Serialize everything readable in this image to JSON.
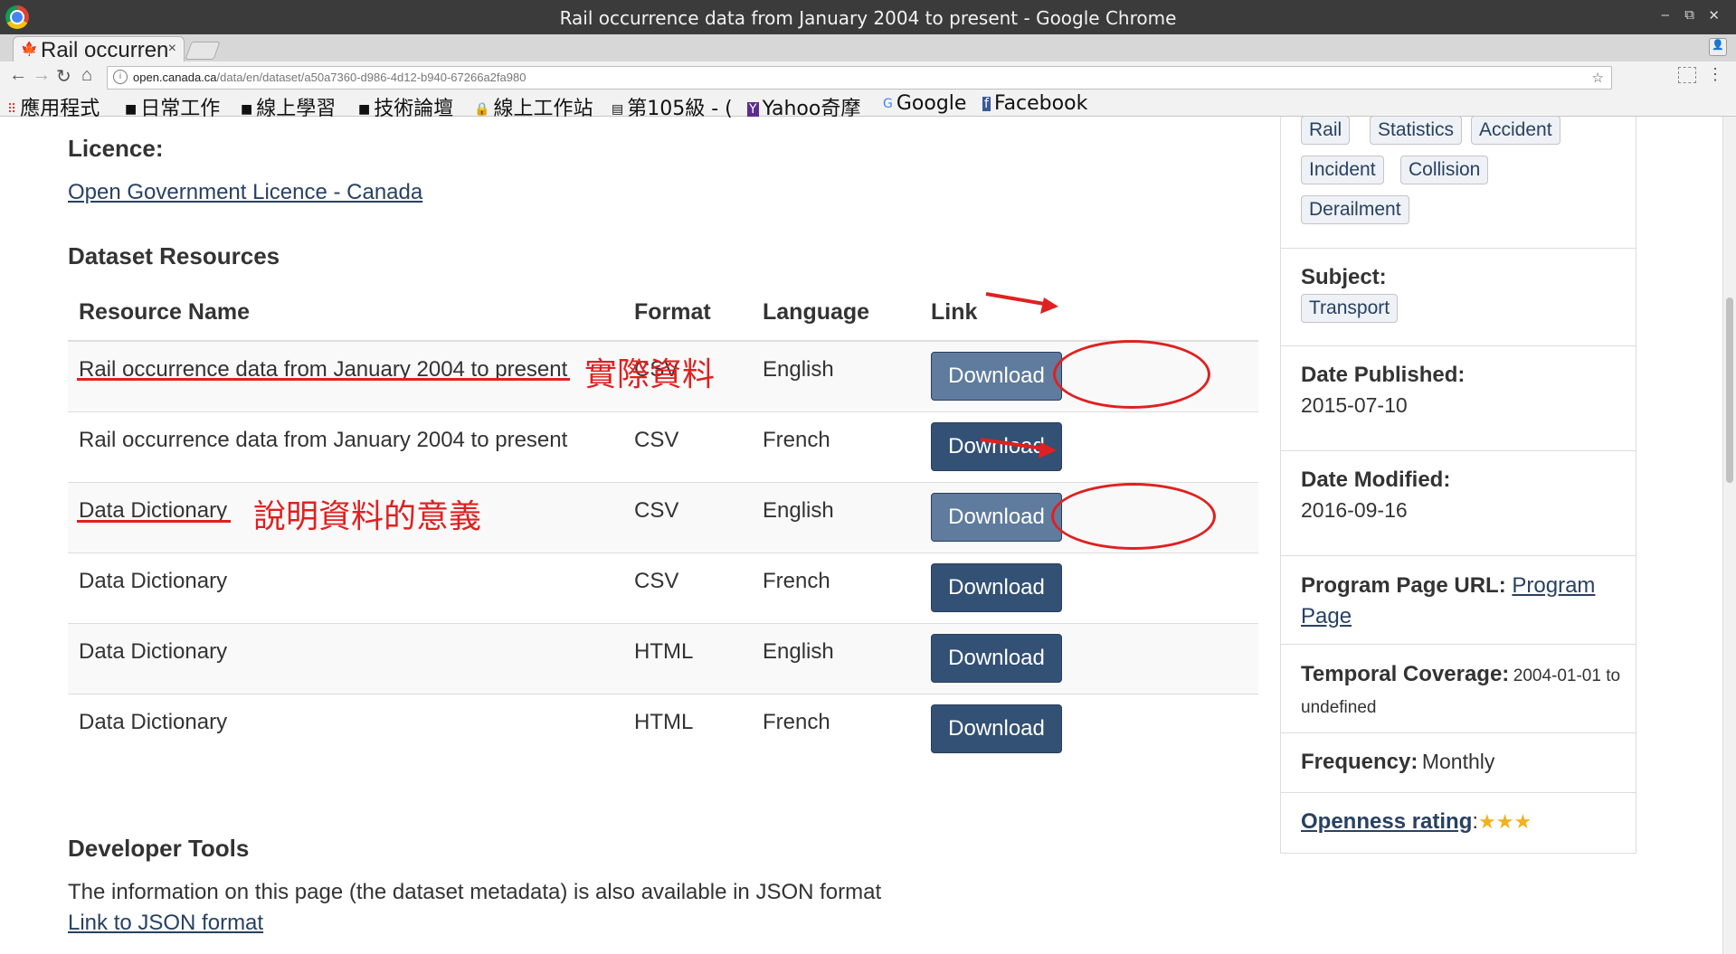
{
  "window": {
    "title": "Rail occurrence data from January 2004 to present - Google Chrome"
  },
  "tab": {
    "label": "Rail occurrence",
    "close": "×"
  },
  "address_bar": {
    "domain": "open.canada.ca",
    "path": "/data/en/dataset/a50a7360-d986-4d12-b940-67266a2fa980"
  },
  "bookmarks": [
    {
      "label": "應用程式",
      "icon": "apps-grid-icon"
    },
    {
      "label": "日常工作",
      "icon": "folder-icon"
    },
    {
      "label": "線上學習",
      "icon": "folder-icon"
    },
    {
      "label": "技術論壇",
      "icon": "folder-icon"
    },
    {
      "label": "線上工作站",
      "icon": "lock-icon"
    },
    {
      "label": "第105級 - (",
      "icon": "page-icon"
    },
    {
      "label": "Yahoo奇摩",
      "icon": "yahoo-icon"
    },
    {
      "label": "Google",
      "icon": "google-icon"
    },
    {
      "label": "Facebook",
      "icon": "facebook-icon"
    }
  ],
  "licence": {
    "heading": "Licence:",
    "link": "Open Government Licence - Canada"
  },
  "resources": {
    "heading": "Dataset Resources",
    "columns": [
      "Resource Name",
      "Format",
      "Language",
      "Link"
    ],
    "rows": [
      {
        "name": "Rail occurrence data from January 2004 to present",
        "format": "CSV",
        "language": "English",
        "link": "Download"
      },
      {
        "name": "Rail occurrence data from January 2004 to present",
        "format": "CSV",
        "language": "French",
        "link": "Download"
      },
      {
        "name": "Data Dictionary",
        "format": "CSV",
        "language": "English",
        "link": "Download"
      },
      {
        "name": "Data Dictionary",
        "format": "CSV",
        "language": "French",
        "link": "Download"
      },
      {
        "name": "Data Dictionary",
        "format": "HTML",
        "language": "English",
        "link": "Download"
      },
      {
        "name": "Data Dictionary",
        "format": "HTML",
        "language": "French",
        "link": "Download"
      }
    ]
  },
  "annotations": {
    "actual_data": "實際資料",
    "dictionary_note": "說明資料的意義"
  },
  "developer": {
    "heading": "Developer Tools",
    "text": "The information on this page (the dataset metadata) is also available in JSON format",
    "link": "Link to JSON format"
  },
  "sidebar": {
    "keywords": [
      "Rail",
      "Statistics",
      "Accident",
      "Incident",
      "Collision",
      "Derailment"
    ],
    "subject_label": "Subject:",
    "subject_value": "Transport",
    "date_published_label": "Date Published:",
    "date_published": "2015-07-10",
    "date_modified_label": "Date Modified:",
    "date_modified": "2016-09-16",
    "program_label": "Program Page URL:",
    "program_link": "Program Page",
    "temporal_label": "Temporal Coverage:",
    "temporal_value": "2004-01-01 to undefined",
    "frequency_label": "Frequency:",
    "frequency_value": "Monthly",
    "openness_label": "Openness rating",
    "openness_colon": ":",
    "openness_stars": "★★★"
  },
  "colors": {
    "link": "#284162",
    "button": "#335075",
    "annotation": "#e02020"
  }
}
